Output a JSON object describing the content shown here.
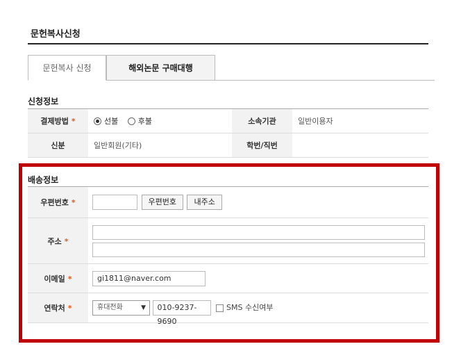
{
  "page": {
    "title": "문헌복사신청"
  },
  "tabs": [
    {
      "label": "문헌복사 신청",
      "active": true
    },
    {
      "label": "해외논문 구매대행",
      "active": false
    }
  ],
  "application_info": {
    "section_title": "신청정보",
    "payment_label": "결제방법",
    "payment_options": [
      {
        "label": "선불",
        "selected": true
      },
      {
        "label": "후불",
        "selected": false
      }
    ],
    "affiliation_label": "소속기관",
    "affiliation_value": "일반이용자",
    "status_label": "신분",
    "status_value": "일반회원(기타)",
    "student_id_label": "학번/직번",
    "student_id_value": ""
  },
  "shipping_info": {
    "section_title": "배송정보",
    "postal_label": "우편번호",
    "postal_value": "",
    "postal_button": "우편번호",
    "my_address_button": "내주소",
    "address_label": "주소",
    "address_line1": "",
    "address_line2": "",
    "email_label": "이메일",
    "email_value": "gi1811@naver.com",
    "contact_label": "연락처",
    "phone_type": "휴대전화",
    "phone_value": "010-9237-9690",
    "sms_label": "SMS 수신여부",
    "sms_checked": false
  },
  "required_mark": "*",
  "colors": {
    "highlight_border": "#c00000",
    "required": "#e05a1c"
  }
}
